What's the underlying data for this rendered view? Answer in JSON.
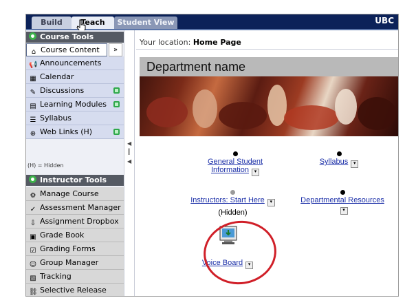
{
  "tabs": [
    {
      "label": "Build"
    },
    {
      "label": "Teach"
    },
    {
      "label": "Student View"
    }
  ],
  "brand": "UBC",
  "course_tools": {
    "header": "Course Tools",
    "selected_item": "Course Content",
    "items": [
      {
        "label": "Announcements",
        "icon": "megaphone-icon"
      },
      {
        "label": "Calendar",
        "icon": "calendar-icon"
      },
      {
        "label": "Discussions",
        "icon": "discussion-icon"
      },
      {
        "label": "Learning Modules",
        "icon": "module-icon"
      },
      {
        "label": "Syllabus",
        "icon": "syllabus-icon"
      },
      {
        "label": "Web Links (H)",
        "icon": "web-links-icon"
      }
    ],
    "hidden_note": "(H) = Hidden"
  },
  "instructor_tools": {
    "header": "Instructor Tools",
    "items": [
      {
        "label": "Manage Course"
      },
      {
        "label": "Assessment Manager"
      },
      {
        "label": "Assignment Dropbox"
      },
      {
        "label": "Grade Book"
      },
      {
        "label": "Grading Forms"
      },
      {
        "label": "Group Manager"
      },
      {
        "label": "Tracking"
      },
      {
        "label": "Selective Release"
      }
    ]
  },
  "location": {
    "prefix": "Your location:",
    "page": "Home Page"
  },
  "banner_title": "Department name",
  "links": {
    "general_info_line1": "General Student",
    "general_info_line2": "Information",
    "syllabus": "Syllabus",
    "instructors_start": "Instructors: Start Here",
    "instructors_hidden": "(Hidden)",
    "departmental_resources": "Departmental Resources",
    "voice_board": "Voice Board"
  },
  "colors": {
    "accent_red": "#d01f28",
    "nav_bar": "#0c2259",
    "link_blue": "#1b2fa8"
  }
}
